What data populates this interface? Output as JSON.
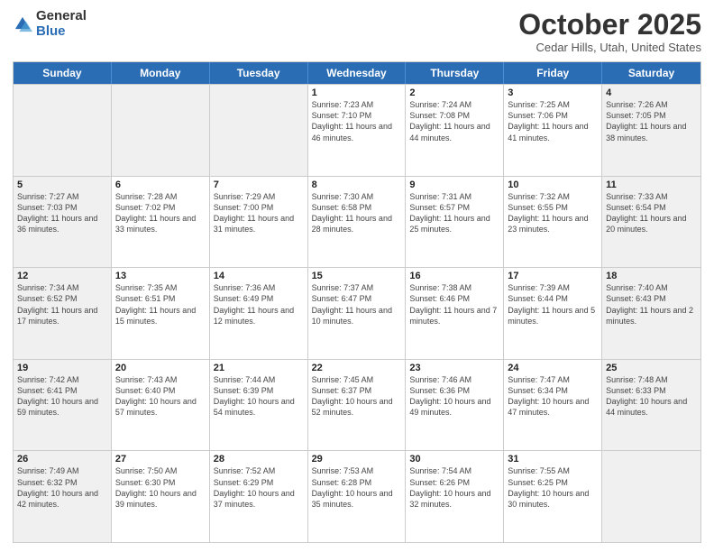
{
  "header": {
    "logo_general": "General",
    "logo_blue": "Blue",
    "month_title": "October 2025",
    "location": "Cedar Hills, Utah, United States"
  },
  "days_of_week": [
    "Sunday",
    "Monday",
    "Tuesday",
    "Wednesday",
    "Thursday",
    "Friday",
    "Saturday"
  ],
  "rows": [
    [
      {
        "day": "",
        "info": "",
        "shaded": true
      },
      {
        "day": "",
        "info": "",
        "shaded": true
      },
      {
        "day": "",
        "info": "",
        "shaded": true
      },
      {
        "day": "1",
        "info": "Sunrise: 7:23 AM\nSunset: 7:10 PM\nDaylight: 11 hours and 46 minutes.",
        "shaded": false
      },
      {
        "day": "2",
        "info": "Sunrise: 7:24 AM\nSunset: 7:08 PM\nDaylight: 11 hours and 44 minutes.",
        "shaded": false
      },
      {
        "day": "3",
        "info": "Sunrise: 7:25 AM\nSunset: 7:06 PM\nDaylight: 11 hours and 41 minutes.",
        "shaded": false
      },
      {
        "day": "4",
        "info": "Sunrise: 7:26 AM\nSunset: 7:05 PM\nDaylight: 11 hours and 38 minutes.",
        "shaded": true
      }
    ],
    [
      {
        "day": "5",
        "info": "Sunrise: 7:27 AM\nSunset: 7:03 PM\nDaylight: 11 hours and 36 minutes.",
        "shaded": true
      },
      {
        "day": "6",
        "info": "Sunrise: 7:28 AM\nSunset: 7:02 PM\nDaylight: 11 hours and 33 minutes.",
        "shaded": false
      },
      {
        "day": "7",
        "info": "Sunrise: 7:29 AM\nSunset: 7:00 PM\nDaylight: 11 hours and 31 minutes.",
        "shaded": false
      },
      {
        "day": "8",
        "info": "Sunrise: 7:30 AM\nSunset: 6:58 PM\nDaylight: 11 hours and 28 minutes.",
        "shaded": false
      },
      {
        "day": "9",
        "info": "Sunrise: 7:31 AM\nSunset: 6:57 PM\nDaylight: 11 hours and 25 minutes.",
        "shaded": false
      },
      {
        "day": "10",
        "info": "Sunrise: 7:32 AM\nSunset: 6:55 PM\nDaylight: 11 hours and 23 minutes.",
        "shaded": false
      },
      {
        "day": "11",
        "info": "Sunrise: 7:33 AM\nSunset: 6:54 PM\nDaylight: 11 hours and 20 minutes.",
        "shaded": true
      }
    ],
    [
      {
        "day": "12",
        "info": "Sunrise: 7:34 AM\nSunset: 6:52 PM\nDaylight: 11 hours and 17 minutes.",
        "shaded": true
      },
      {
        "day": "13",
        "info": "Sunrise: 7:35 AM\nSunset: 6:51 PM\nDaylight: 11 hours and 15 minutes.",
        "shaded": false
      },
      {
        "day": "14",
        "info": "Sunrise: 7:36 AM\nSunset: 6:49 PM\nDaylight: 11 hours and 12 minutes.",
        "shaded": false
      },
      {
        "day": "15",
        "info": "Sunrise: 7:37 AM\nSunset: 6:47 PM\nDaylight: 11 hours and 10 minutes.",
        "shaded": false
      },
      {
        "day": "16",
        "info": "Sunrise: 7:38 AM\nSunset: 6:46 PM\nDaylight: 11 hours and 7 minutes.",
        "shaded": false
      },
      {
        "day": "17",
        "info": "Sunrise: 7:39 AM\nSunset: 6:44 PM\nDaylight: 11 hours and 5 minutes.",
        "shaded": false
      },
      {
        "day": "18",
        "info": "Sunrise: 7:40 AM\nSunset: 6:43 PM\nDaylight: 11 hours and 2 minutes.",
        "shaded": true
      }
    ],
    [
      {
        "day": "19",
        "info": "Sunrise: 7:42 AM\nSunset: 6:41 PM\nDaylight: 10 hours and 59 minutes.",
        "shaded": true
      },
      {
        "day": "20",
        "info": "Sunrise: 7:43 AM\nSunset: 6:40 PM\nDaylight: 10 hours and 57 minutes.",
        "shaded": false
      },
      {
        "day": "21",
        "info": "Sunrise: 7:44 AM\nSunset: 6:39 PM\nDaylight: 10 hours and 54 minutes.",
        "shaded": false
      },
      {
        "day": "22",
        "info": "Sunrise: 7:45 AM\nSunset: 6:37 PM\nDaylight: 10 hours and 52 minutes.",
        "shaded": false
      },
      {
        "day": "23",
        "info": "Sunrise: 7:46 AM\nSunset: 6:36 PM\nDaylight: 10 hours and 49 minutes.",
        "shaded": false
      },
      {
        "day": "24",
        "info": "Sunrise: 7:47 AM\nSunset: 6:34 PM\nDaylight: 10 hours and 47 minutes.",
        "shaded": false
      },
      {
        "day": "25",
        "info": "Sunrise: 7:48 AM\nSunset: 6:33 PM\nDaylight: 10 hours and 44 minutes.",
        "shaded": true
      }
    ],
    [
      {
        "day": "26",
        "info": "Sunrise: 7:49 AM\nSunset: 6:32 PM\nDaylight: 10 hours and 42 minutes.",
        "shaded": true
      },
      {
        "day": "27",
        "info": "Sunrise: 7:50 AM\nSunset: 6:30 PM\nDaylight: 10 hours and 39 minutes.",
        "shaded": false
      },
      {
        "day": "28",
        "info": "Sunrise: 7:52 AM\nSunset: 6:29 PM\nDaylight: 10 hours and 37 minutes.",
        "shaded": false
      },
      {
        "day": "29",
        "info": "Sunrise: 7:53 AM\nSunset: 6:28 PM\nDaylight: 10 hours and 35 minutes.",
        "shaded": false
      },
      {
        "day": "30",
        "info": "Sunrise: 7:54 AM\nSunset: 6:26 PM\nDaylight: 10 hours and 32 minutes.",
        "shaded": false
      },
      {
        "day": "31",
        "info": "Sunrise: 7:55 AM\nSunset: 6:25 PM\nDaylight: 10 hours and 30 minutes.",
        "shaded": false
      },
      {
        "day": "",
        "info": "",
        "shaded": true
      }
    ]
  ]
}
